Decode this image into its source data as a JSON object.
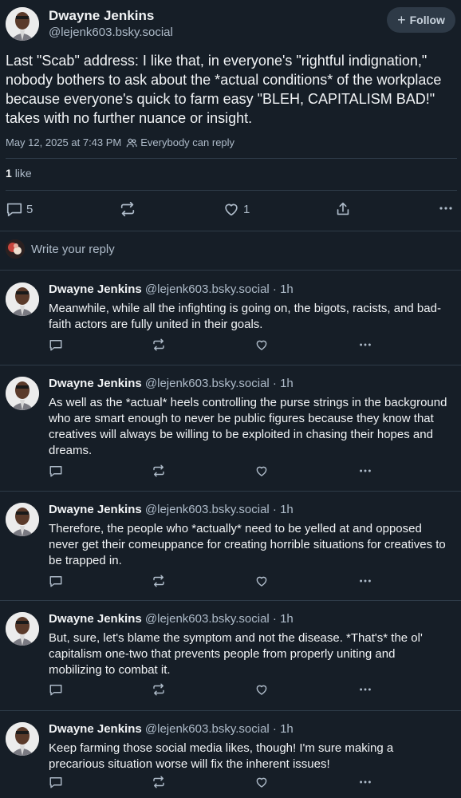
{
  "post": {
    "author_name": "Dwayne Jenkins",
    "author_handle": "@lejenk603.bsky.social",
    "follow_label": "Follow",
    "text": "Last \"Scab\" address: I like that, in everyone's \"rightful indignation,\" nobody bothers to ask about the *actual conditions* of the workplace because everyone's quick to farm easy \"BLEH, CAPITALISM BAD!\" takes with no further nuance or insight.",
    "timestamp": "May 12, 2025 at 7:43 PM",
    "reply_setting": "Everybody can reply",
    "like_count": "1",
    "like_label": "like",
    "reply_count": "5",
    "heart_count": "1"
  },
  "reply_box": {
    "placeholder": "Write your reply"
  },
  "replies": [
    {
      "name": "Dwayne Jenkins",
      "handle": "@lejenk603.bsky.social · 1h",
      "text": "Meanwhile, while all the infighting is going on, the bigots, racists, and bad-faith actors are fully united in their goals."
    },
    {
      "name": "Dwayne Jenkins",
      "handle": "@lejenk603.bsky.social · 1h",
      "text": "As well as the *actual* heels controlling the purse strings in the background who are smart enough to never be public figures because they know that creatives will always be willing to be exploited in chasing their hopes and dreams."
    },
    {
      "name": "Dwayne Jenkins",
      "handle": "@lejenk603.bsky.social · 1h",
      "text": "Therefore, the people who *actually* need to be yelled at and opposed never get their comeuppance for creating horrible situations for creatives to be trapped in."
    },
    {
      "name": "Dwayne Jenkins",
      "handle": "@lejenk603.bsky.social · 1h",
      "text": "But, sure, let's blame the symptom and not the disease. *That's* the ol' capitalism one-two that prevents people from properly uniting and mobilizing to combat it."
    },
    {
      "name": "Dwayne Jenkins",
      "handle": "@lejenk603.bsky.social · 1h",
      "text": "Keep farming those social media likes, though! I'm sure making a precarious situation worse will fix the inherent issues!"
    }
  ],
  "colors": {
    "background": "#161e27",
    "text": "#f1f3f5",
    "muted": "#aebbc9",
    "divider": "#2e3b48",
    "button": "#2e3a47"
  },
  "icons": [
    "plus-icon",
    "people-icon",
    "comment-icon",
    "repost-icon",
    "heart-icon",
    "share-icon",
    "more-icon"
  ]
}
